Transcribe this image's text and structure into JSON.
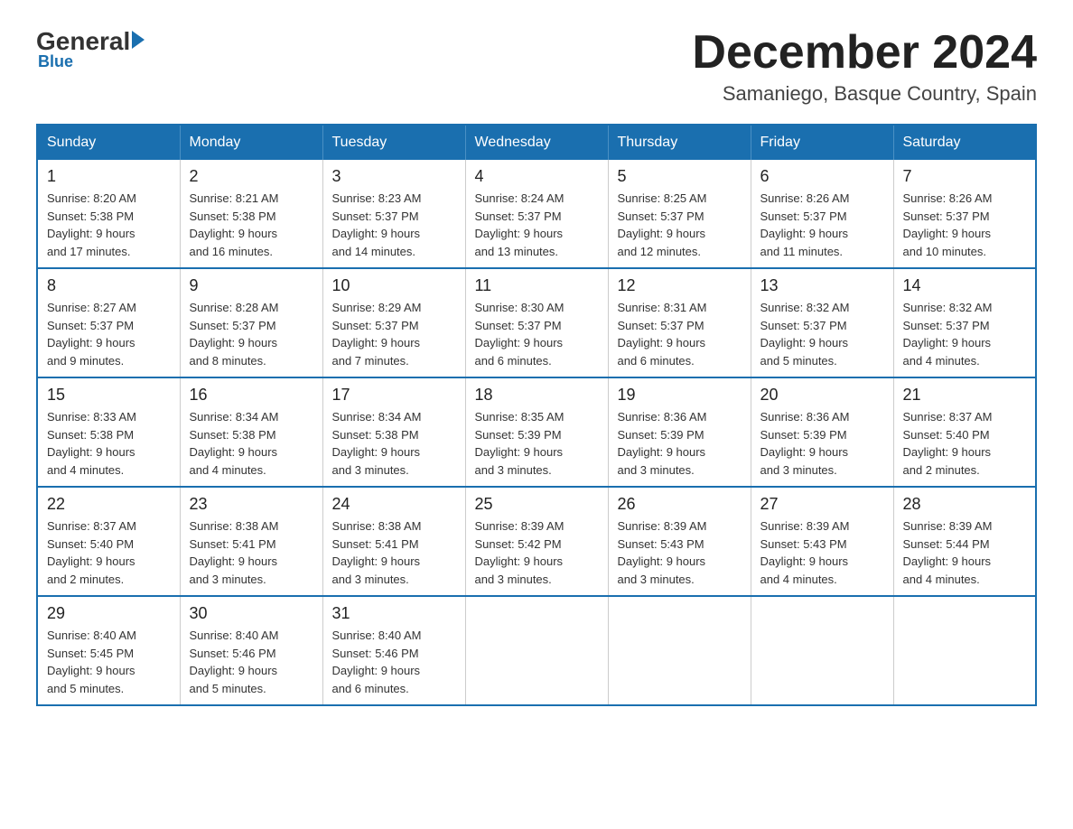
{
  "logo": {
    "general": "General",
    "triangle": "",
    "blue": "Blue"
  },
  "title": {
    "month": "December 2024",
    "location": "Samaniego, Basque Country, Spain"
  },
  "days_of_week": [
    "Sunday",
    "Monday",
    "Tuesday",
    "Wednesday",
    "Thursday",
    "Friday",
    "Saturday"
  ],
  "weeks": [
    [
      {
        "day": "1",
        "sunrise": "8:20 AM",
        "sunset": "5:38 PM",
        "daylight": "9 hours and 17 minutes."
      },
      {
        "day": "2",
        "sunrise": "8:21 AM",
        "sunset": "5:38 PM",
        "daylight": "9 hours and 16 minutes."
      },
      {
        "day": "3",
        "sunrise": "8:23 AM",
        "sunset": "5:37 PM",
        "daylight": "9 hours and 14 minutes."
      },
      {
        "day": "4",
        "sunrise": "8:24 AM",
        "sunset": "5:37 PM",
        "daylight": "9 hours and 13 minutes."
      },
      {
        "day": "5",
        "sunrise": "8:25 AM",
        "sunset": "5:37 PM",
        "daylight": "9 hours and 12 minutes."
      },
      {
        "day": "6",
        "sunrise": "8:26 AM",
        "sunset": "5:37 PM",
        "daylight": "9 hours and 11 minutes."
      },
      {
        "day": "7",
        "sunrise": "8:26 AM",
        "sunset": "5:37 PM",
        "daylight": "9 hours and 10 minutes."
      }
    ],
    [
      {
        "day": "8",
        "sunrise": "8:27 AM",
        "sunset": "5:37 PM",
        "daylight": "9 hours and 9 minutes."
      },
      {
        "day": "9",
        "sunrise": "8:28 AM",
        "sunset": "5:37 PM",
        "daylight": "9 hours and 8 minutes."
      },
      {
        "day": "10",
        "sunrise": "8:29 AM",
        "sunset": "5:37 PM",
        "daylight": "9 hours and 7 minutes."
      },
      {
        "day": "11",
        "sunrise": "8:30 AM",
        "sunset": "5:37 PM",
        "daylight": "9 hours and 6 minutes."
      },
      {
        "day": "12",
        "sunrise": "8:31 AM",
        "sunset": "5:37 PM",
        "daylight": "9 hours and 6 minutes."
      },
      {
        "day": "13",
        "sunrise": "8:32 AM",
        "sunset": "5:37 PM",
        "daylight": "9 hours and 5 minutes."
      },
      {
        "day": "14",
        "sunrise": "8:32 AM",
        "sunset": "5:37 PM",
        "daylight": "9 hours and 4 minutes."
      }
    ],
    [
      {
        "day": "15",
        "sunrise": "8:33 AM",
        "sunset": "5:38 PM",
        "daylight": "9 hours and 4 minutes."
      },
      {
        "day": "16",
        "sunrise": "8:34 AM",
        "sunset": "5:38 PM",
        "daylight": "9 hours and 4 minutes."
      },
      {
        "day": "17",
        "sunrise": "8:34 AM",
        "sunset": "5:38 PM",
        "daylight": "9 hours and 3 minutes."
      },
      {
        "day": "18",
        "sunrise": "8:35 AM",
        "sunset": "5:39 PM",
        "daylight": "9 hours and 3 minutes."
      },
      {
        "day": "19",
        "sunrise": "8:36 AM",
        "sunset": "5:39 PM",
        "daylight": "9 hours and 3 minutes."
      },
      {
        "day": "20",
        "sunrise": "8:36 AM",
        "sunset": "5:39 PM",
        "daylight": "9 hours and 3 minutes."
      },
      {
        "day": "21",
        "sunrise": "8:37 AM",
        "sunset": "5:40 PM",
        "daylight": "9 hours and 2 minutes."
      }
    ],
    [
      {
        "day": "22",
        "sunrise": "8:37 AM",
        "sunset": "5:40 PM",
        "daylight": "9 hours and 2 minutes."
      },
      {
        "day": "23",
        "sunrise": "8:38 AM",
        "sunset": "5:41 PM",
        "daylight": "9 hours and 3 minutes."
      },
      {
        "day": "24",
        "sunrise": "8:38 AM",
        "sunset": "5:41 PM",
        "daylight": "9 hours and 3 minutes."
      },
      {
        "day": "25",
        "sunrise": "8:39 AM",
        "sunset": "5:42 PM",
        "daylight": "9 hours and 3 minutes."
      },
      {
        "day": "26",
        "sunrise": "8:39 AM",
        "sunset": "5:43 PM",
        "daylight": "9 hours and 3 minutes."
      },
      {
        "day": "27",
        "sunrise": "8:39 AM",
        "sunset": "5:43 PM",
        "daylight": "9 hours and 4 minutes."
      },
      {
        "day": "28",
        "sunrise": "8:39 AM",
        "sunset": "5:44 PM",
        "daylight": "9 hours and 4 minutes."
      }
    ],
    [
      {
        "day": "29",
        "sunrise": "8:40 AM",
        "sunset": "5:45 PM",
        "daylight": "9 hours and 5 minutes."
      },
      {
        "day": "30",
        "sunrise": "8:40 AM",
        "sunset": "5:46 PM",
        "daylight": "9 hours and 5 minutes."
      },
      {
        "day": "31",
        "sunrise": "8:40 AM",
        "sunset": "5:46 PM",
        "daylight": "9 hours and 6 minutes."
      },
      null,
      null,
      null,
      null
    ]
  ],
  "labels": {
    "sunrise": "Sunrise:",
    "sunset": "Sunset:",
    "daylight": "Daylight:"
  }
}
